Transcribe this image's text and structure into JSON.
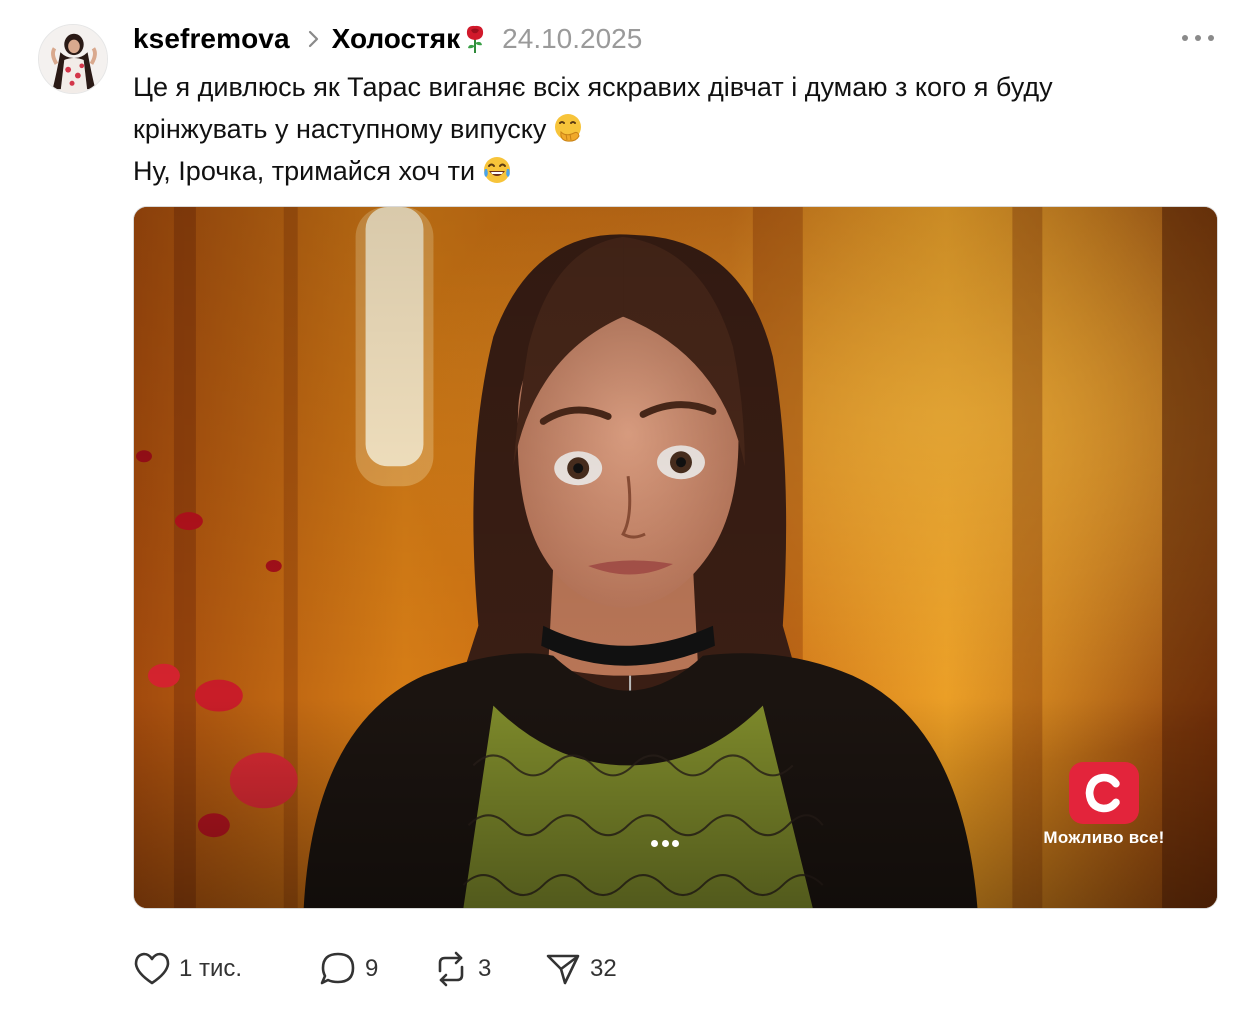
{
  "post": {
    "author": "ksefremova",
    "topic": "Холостяк",
    "topic_emoji": "rose-icon",
    "date": "24.10.2025",
    "text_lines": [
      "Це я дивлюсь як Тарас виганяє всіх яскравих дівчат і думаю з кого я буду",
      "крінжувать у наступному випуску",
      "Ну, Ірочка, тримайся хоч ти"
    ],
    "line2_emoji": "face-with-hand-over-mouth-icon",
    "line3_emoji": "tears-of-joy-icon"
  },
  "media": {
    "watermark_text": "Можливо все!",
    "watermark_logo": "C",
    "menu_icon": "more-dots-icon"
  },
  "actions": {
    "likes": "1 тис.",
    "comments": "9",
    "reposts": "3",
    "shares": "32"
  },
  "colors": {
    "accent_red": "#e3243b",
    "muted_text": "#9a9a9a"
  }
}
